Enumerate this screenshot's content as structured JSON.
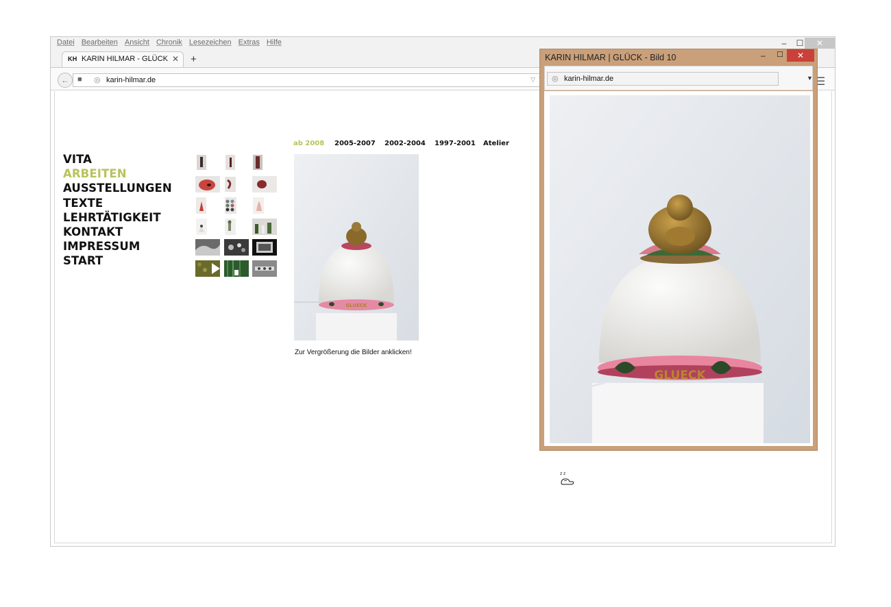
{
  "browser": {
    "menu": [
      "Datei",
      "Bearbeiten",
      "Ansicht",
      "Chronik",
      "Lesezeichen",
      "Extras",
      "Hilfe"
    ],
    "window_controls": {
      "minimize": "–",
      "maximize": "☐",
      "close": "✕"
    },
    "tab": {
      "favicon": "KH",
      "title": "KARIN HILMAR - GLÜCK",
      "close": "✕"
    },
    "new_tab": "+",
    "url": "karin-hilmar.de",
    "icons": [
      "back-arrow-icon",
      "folder-icon",
      "globe-icon",
      "dropdown-icon",
      "reload-icon",
      "hamburger-menu-icon"
    ]
  },
  "site": {
    "nav": [
      {
        "label": "VITA",
        "active": false
      },
      {
        "label": "ARBEITEN",
        "active": true
      },
      {
        "label": "AUSSTELLUNGEN",
        "active": false
      },
      {
        "label": "TEXTE",
        "active": false
      },
      {
        "label": "LEHRTÄTIGKEIT",
        "active": false
      },
      {
        "label": "KONTAKT",
        "active": false
      },
      {
        "label": "IMPRESSUM",
        "active": false
      },
      {
        "label": "START",
        "active": false
      }
    ],
    "year_tabs": [
      {
        "label": "ab 2008",
        "active": true
      },
      {
        "label": "2005-2007",
        "active": false
      },
      {
        "label": "2002-2004",
        "active": false
      },
      {
        "label": "1997-2001",
        "active": false
      },
      {
        "label": "Atelier",
        "active": false
      }
    ],
    "caption": "Zur Vergrößerung die Bilder anklicken!",
    "colors": {
      "accent": "#b7c35a",
      "text": "#111111"
    },
    "photo_label": "GLUECK"
  },
  "popup": {
    "title": "KARIN HILMAR | GLÜCK - Bild 10",
    "url": "karin-hilmar.de",
    "controls": {
      "minimize": "–",
      "maximize": "☐",
      "close": "✕"
    },
    "frame_color": "#c9a07a"
  },
  "cursor": {
    "type": "sleeping-cursor-icon",
    "label": "z z"
  }
}
